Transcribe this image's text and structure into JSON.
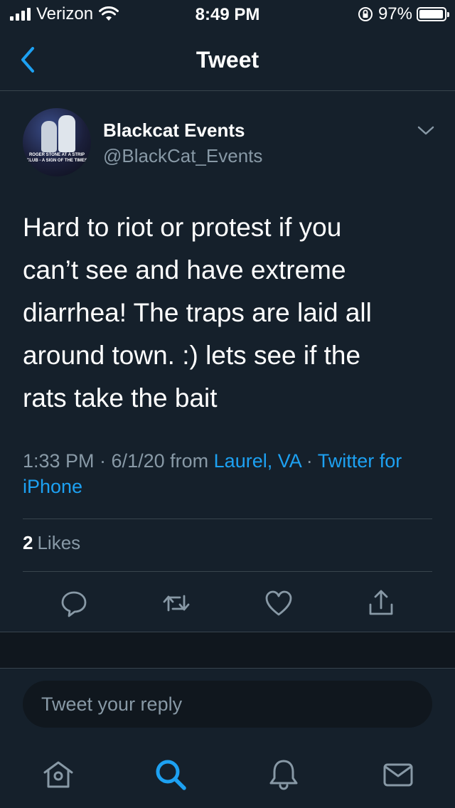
{
  "status_bar": {
    "carrier": "Verizon",
    "time": "8:49 PM",
    "battery": "97%",
    "battery_level": 0.97
  },
  "nav": {
    "title": "Tweet",
    "back_icon": "chevron-left-icon"
  },
  "tweet": {
    "avatar_caption": "ROGER STONE AT A STRIP CLUB - A SIGN OF THE TIMES",
    "display_name": "Blackcat Events",
    "handle": "@BlackCat_Events",
    "text": "Hard to riot or protest if you\ncan’t see and have extreme\ndiarrhea! The traps are laid all\naround town. :) lets see if the\nrats take the bait",
    "time": "1:33 PM · 6/1/20",
    "from_label": "from",
    "location": "Laurel, VA",
    "separator": "·",
    "source": "Twitter for iPhone",
    "likes_count": "2",
    "likes_label": "Likes"
  },
  "actions": {
    "reply_icon": "comment-icon",
    "retweet_icon": "retweet-icon",
    "like_icon": "heart-icon",
    "share_icon": "share-icon"
  },
  "reply": {
    "placeholder": "Tweet your reply"
  },
  "tabs": {
    "home": "home-icon",
    "search": "search-icon",
    "notifications": "bell-icon",
    "messages": "mail-icon"
  },
  "colors": {
    "background": "#15202b",
    "accent": "#1da1f2",
    "secondary_text": "#8899a6",
    "divider": "#38444d"
  }
}
